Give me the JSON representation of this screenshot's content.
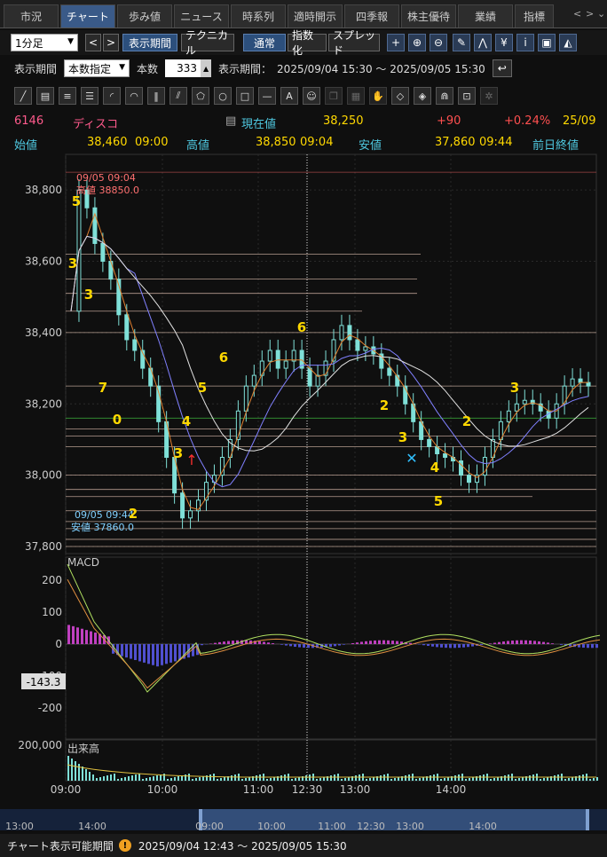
{
  "tabs": [
    "市況",
    "チャート",
    "歩み値",
    "ニュース",
    "時系列",
    "適時開示",
    "四季報",
    "株主優待",
    "業績",
    "指標"
  ],
  "active_tab": 1,
  "toolbar": {
    "interval": "1分足",
    "display_period_btn": "表示期間",
    "technical_btn": "テクニカル",
    "normal_btn": "通常",
    "index_btn": "指数化",
    "spread_btn": "スプレッド"
  },
  "period": {
    "label": "表示期間",
    "mode": "本数指定",
    "count_label": "本数",
    "count": "333",
    "range_label": "表示期間：",
    "range": "2025/09/04 15:30 ～ 2025/09/05 15:30"
  },
  "quote": {
    "code": "6146",
    "name": "ディスコ",
    "current_label": "現在値",
    "current": "38,250",
    "change": "+90",
    "change_pct": "+0.24%",
    "date": "25/09",
    "open_label": "始値",
    "open": "38,460",
    "open_time": "09:00",
    "high_label": "高値",
    "high": "38,850",
    "high_time": "09:04",
    "low_label": "安値",
    "low": "37,860",
    "low_time": "09:44",
    "prev_label": "前日終値"
  },
  "colors": {
    "candle_up": "#7fe0d8",
    "macd_hist_pos": "#c040c0",
    "macd_hist_neg": "#5050d0",
    "accent": "#ffd800",
    "price_red": "#ff5050"
  },
  "chart_data": {
    "type": "candlestick",
    "y_ticks": [
      "38,800",
      "38,600",
      "38,400",
      "38,200",
      "38,000",
      "37,800"
    ],
    "ylim": [
      37780,
      38900
    ],
    "x_ticks": [
      "09:00",
      "10:00",
      "11:00",
      "12:30",
      "13:00",
      "14:00"
    ],
    "annotation_high": {
      "time": "09/05 09:04",
      "label": "高値 38850.0"
    },
    "annotation_low": {
      "time": "09/05 09:44",
      "label": "安値 37860.0"
    },
    "counts": [
      "5",
      "3",
      "3",
      "6",
      "7",
      "0",
      "2",
      "3",
      "4",
      "5",
      "6",
      "2",
      "3",
      "4",
      "5",
      "2",
      "3"
    ],
    "macd": {
      "label": "MACD",
      "ticks": [
        "200",
        "100",
        "0",
        "-100",
        "-200"
      ],
      "value": "-143.3"
    },
    "volume": {
      "label": "出来高",
      "tick": "200,000"
    },
    "nav_ticks": [
      "13:00",
      "14:00",
      "09:00",
      "10:00",
      "11:00",
      "12:30",
      "13:00",
      "14:00"
    ]
  },
  "status": {
    "label": "チャート表示可能期間",
    "range": "2025/09/04 12:43 ～ 2025/09/05 15:30"
  }
}
